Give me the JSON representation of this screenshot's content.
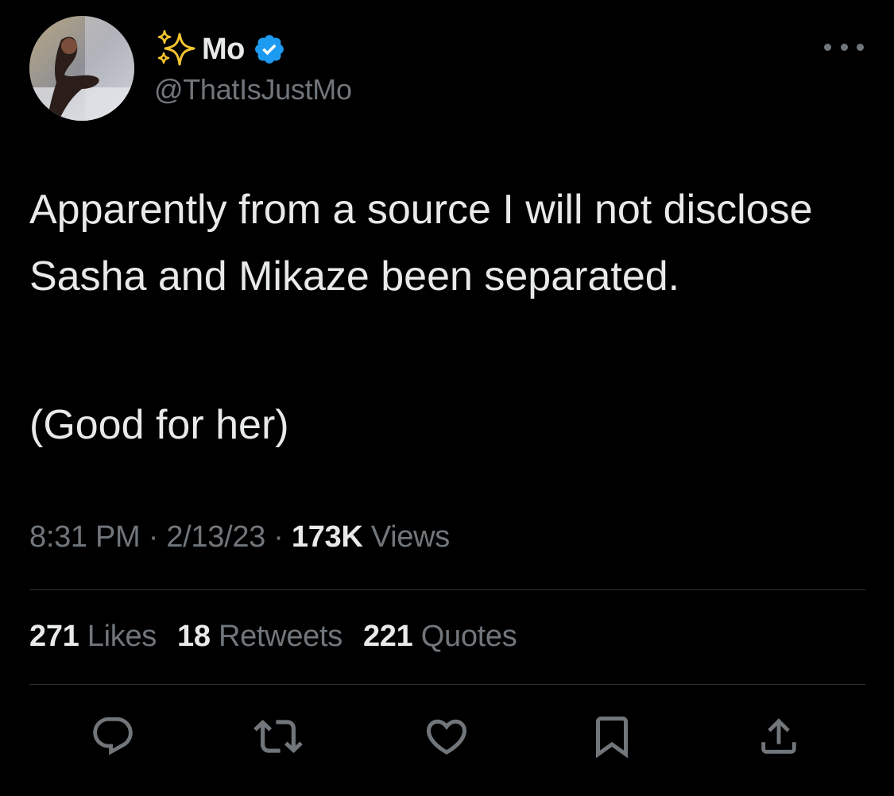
{
  "author": {
    "display_name": "Mo",
    "handle": "@ThatIsJustMo",
    "verified": true,
    "name_prefix_icon": "sparkles-icon",
    "verified_icon": "verified-badge-icon"
  },
  "tweet": {
    "text_paragraph_1": "Apparently from a source I will not disclose Sasha and Mikaze been separated.",
    "text_paragraph_2": "(Good for her)"
  },
  "meta": {
    "time": "8:31 PM",
    "separator": "·",
    "date": "2/13/23",
    "views_count": "173K",
    "views_label": "Views"
  },
  "stats": {
    "likes_count": "271",
    "likes_label": "Likes",
    "retweets_count": "18",
    "retweets_label": "Retweets",
    "quotes_count": "221",
    "quotes_label": "Quotes"
  },
  "actions": [
    "reply-icon",
    "retweet-icon",
    "like-icon",
    "bookmark-icon",
    "share-icon"
  ],
  "colors": {
    "background": "#000000",
    "primary_text": "#e7e9ea",
    "secondary_text": "#71767b",
    "divider": "#2f3336",
    "verified_blue": "#1d9bf0",
    "sparkle": "#ffd84d"
  }
}
